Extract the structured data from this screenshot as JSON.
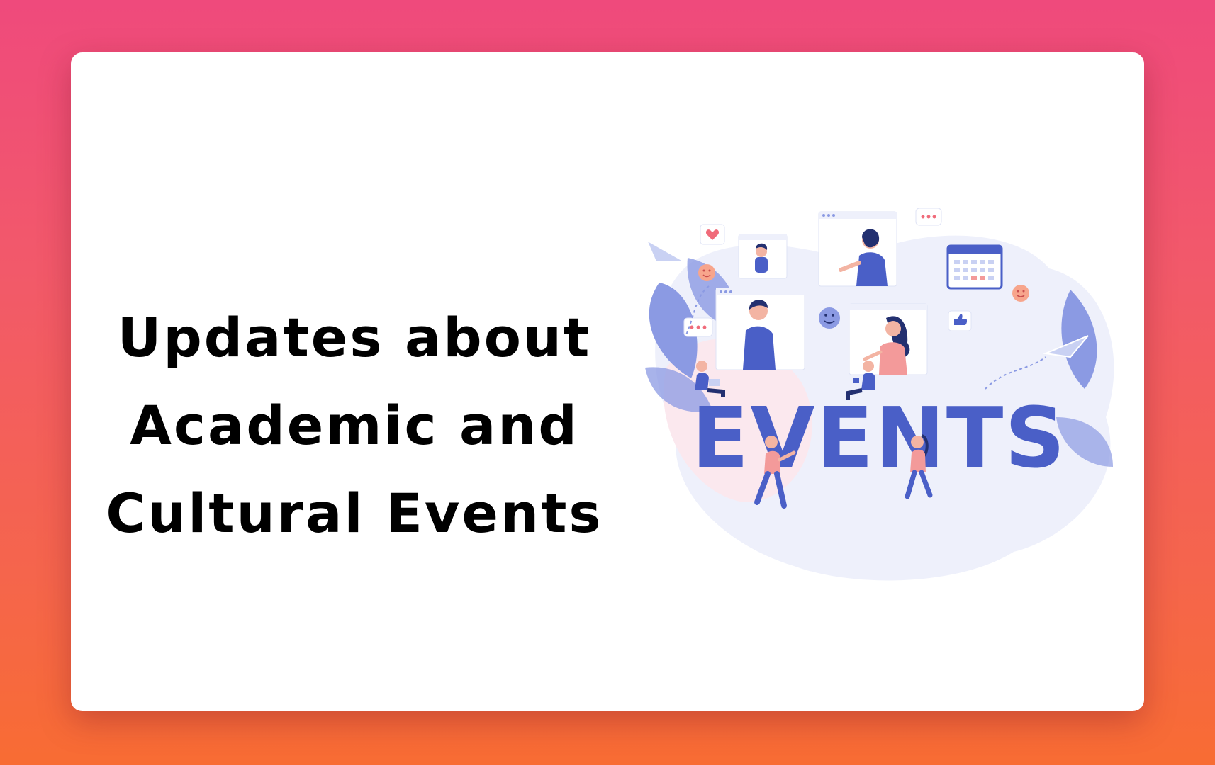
{
  "headline": {
    "line1": "Updates about",
    "line2": "Academic and",
    "line3": "Cultural Events"
  },
  "illustration": {
    "word": "EVENTS",
    "icons": [
      "heart-icon",
      "paper-plane-icon",
      "smiley-icon",
      "calendar-icon",
      "thumbs-up-icon",
      "chat-bubble-icon"
    ]
  },
  "colors": {
    "background_top": "#ef4a7c",
    "background_bottom": "#f86c33",
    "card": "#ffffff",
    "text": "#000000",
    "accent_blue": "#4a5fc7",
    "accent_pink": "#f39a9a"
  }
}
